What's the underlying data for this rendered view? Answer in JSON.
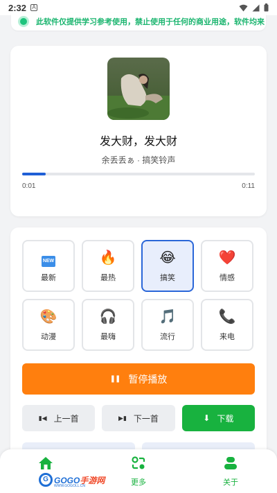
{
  "status_bar": {
    "time": "2:32",
    "a_label": "A"
  },
  "notice": {
    "text": "此软件仅提供学习参考使用，禁止使用于任何的商业用途，软件均来"
  },
  "player": {
    "title": "发大财，发大财",
    "artist": "余丢丢ぁ",
    "category": "搞笑铃声",
    "separator": " · ",
    "current_time": "0:01",
    "total_time": "0:11",
    "progress_fraction": 0.1
  },
  "categories": [
    {
      "icon": "new-icon",
      "glyph": "NEW",
      "label": "最新",
      "active": false
    },
    {
      "icon": "fire-icon",
      "glyph": "🔥",
      "label": "最热",
      "active": false
    },
    {
      "icon": "laughing-face-icon",
      "glyph": "😂",
      "label": "搞笑",
      "active": true
    },
    {
      "icon": "heart-icon",
      "glyph": "❤️",
      "label": "情感",
      "active": false
    },
    {
      "icon": "palette-icon",
      "glyph": "🎨",
      "label": "动漫",
      "active": false
    },
    {
      "icon": "headphones-icon",
      "glyph": "🎧",
      "label": "最嗨",
      "active": false
    },
    {
      "icon": "music-note-icon",
      "glyph": "🎵",
      "label": "流行",
      "active": false
    },
    {
      "icon": "phone-icon",
      "glyph": "📞",
      "label": "来电",
      "active": false
    }
  ],
  "controls": {
    "pause_label": "暂停播放",
    "prev_label": "上一首",
    "next_label": "下一首",
    "download_label": "下载"
  },
  "tabbar": {
    "more_label": "更多",
    "about_label": "关于",
    "logo_text_left": "GOGO",
    "logo_text_right": "手游网",
    "logo_sub": "WWW.GOGOLL.CN"
  },
  "colors": {
    "accent_blue": "#1f5fd6",
    "orange": "#ff7f0e",
    "green": "#18b23f",
    "notice_green": "#1bb56f"
  }
}
